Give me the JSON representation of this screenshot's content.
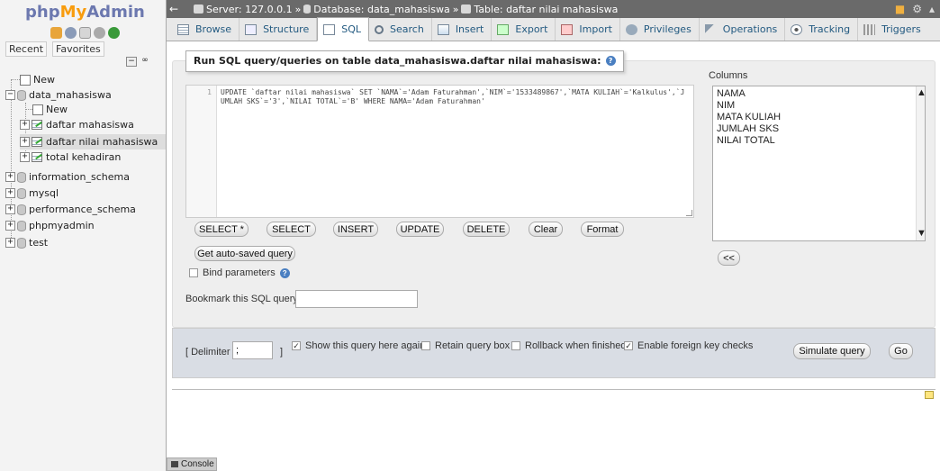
{
  "app": {
    "logo_php": "php",
    "logo_my": "My",
    "logo_admin": "Admin"
  },
  "nav": {
    "recent_label": "Recent",
    "favorites_label": "Favorites",
    "tree": [
      {
        "label": "New",
        "level": 0,
        "kind": "new"
      },
      {
        "label": "data_mahasiswa",
        "level": 0,
        "kind": "db",
        "expanded": true
      },
      {
        "label": "New",
        "level": 1,
        "kind": "new"
      },
      {
        "label": "daftar mahasiswa",
        "level": 1,
        "kind": "table"
      },
      {
        "label": "daftar nilai mahasiswa",
        "level": 1,
        "kind": "table",
        "selected": true
      },
      {
        "label": "total kehadiran",
        "level": 1,
        "kind": "table"
      },
      {
        "label": "information_schema",
        "level": 0,
        "kind": "db"
      },
      {
        "label": "mysql",
        "level": 0,
        "kind": "db"
      },
      {
        "label": "performance_schema",
        "level": 0,
        "kind": "db"
      },
      {
        "label": "phpmyadmin",
        "level": 0,
        "kind": "db"
      },
      {
        "label": "test",
        "level": 0,
        "kind": "db"
      }
    ]
  },
  "breadcrumb": {
    "server": "Server: 127.0.0.1",
    "database": "Database: data_mahasiswa",
    "table": "Table: daftar nilai mahasiswa"
  },
  "tabs": [
    {
      "label": "Browse",
      "icon": "browse-icon"
    },
    {
      "label": "Structure",
      "icon": "structure-icon"
    },
    {
      "label": "SQL",
      "icon": "sql-icon",
      "active": true
    },
    {
      "label": "Search",
      "icon": "search-icon"
    },
    {
      "label": "Insert",
      "icon": "insert-icon"
    },
    {
      "label": "Export",
      "icon": "export-icon"
    },
    {
      "label": "Import",
      "icon": "import-icon"
    },
    {
      "label": "Privileges",
      "icon": "privileges-icon"
    },
    {
      "label": "Operations",
      "icon": "operations-icon"
    },
    {
      "label": "Tracking",
      "icon": "tracking-icon"
    },
    {
      "label": "Triggers",
      "icon": "triggers-icon"
    }
  ],
  "sql_panel": {
    "legend": "Run SQL query/queries on table data_mahasiswa.daftar nilai mahasiswa:",
    "line_number": "1",
    "query": "UPDATE `daftar nilai mahasiswa` SET `NAMA`='Adam Faturahman',`NIM`='1533489867',`MATA KULIAH`='Kalkulus',`JUMLAH SKS`='3',`NILAI TOTAL`='B' WHERE NAMA='Adam Faturahman'",
    "buttons": {
      "select_star": "SELECT *",
      "select": "SELECT",
      "insert": "INSERT",
      "update": "UPDATE",
      "delete": "DELETE",
      "clear": "Clear",
      "format": "Format"
    },
    "get_auto_saved": "Get auto-saved query",
    "bind_parameters": "Bind parameters",
    "bookmark_label": "Bookmark this SQL query:",
    "bookmark_value": ""
  },
  "columns_panel": {
    "label": "Columns",
    "items": [
      "NAMA",
      "NIM",
      "MATA KULIAH",
      "JUMLAH SKS",
      "NILAI TOTAL"
    ],
    "insert_button": "<<"
  },
  "footer": {
    "delimiter_label": "[ Delimiter",
    "delimiter_value": ";",
    "delimiter_close": "]",
    "show_query": "Show this query here again",
    "retain_box": "Retain query box",
    "rollback": "Rollback when finished",
    "foreign_keys": "Enable foreign key checks",
    "simulate": "Simulate query",
    "go": "Go",
    "show_query_checked": true,
    "retain_checked": false,
    "rollback_checked": false,
    "foreign_keys_checked": true
  },
  "console": {
    "label": "Console"
  }
}
